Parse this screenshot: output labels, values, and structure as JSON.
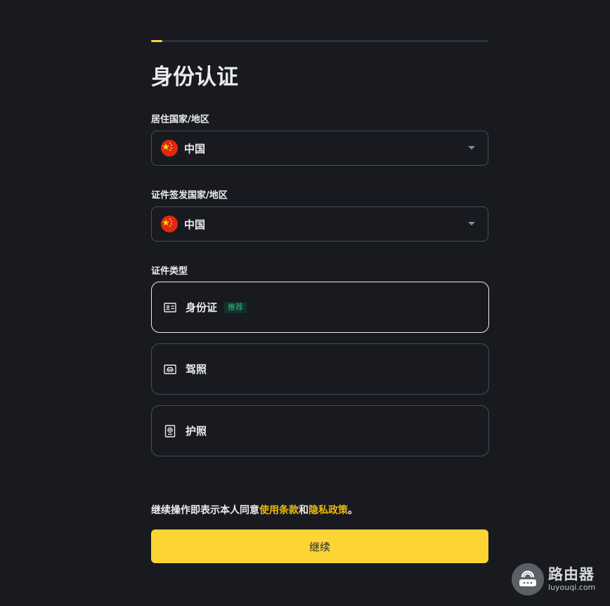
{
  "progress": {
    "value_percent": 3
  },
  "page_title": "身份认证",
  "residence": {
    "label": "居住国家/地区",
    "value": "中国",
    "flag_icon": "china-flag-icon"
  },
  "issuing": {
    "label": "证件签发国家/地区",
    "value": "中国",
    "flag_icon": "china-flag-icon"
  },
  "doc_type": {
    "label": "证件类型",
    "options": [
      {
        "label": "身份证",
        "icon": "id-card-icon",
        "badge": "推荐",
        "selected": true
      },
      {
        "label": "驾照",
        "icon": "driver-license-icon",
        "selected": false
      },
      {
        "label": "护照",
        "icon": "passport-icon",
        "selected": false
      }
    ]
  },
  "terms": {
    "prefix": "继续操作即表示本人同意",
    "terms_link": "使用条款",
    "conjunction": "和",
    "privacy_link": "隐私政策",
    "suffix": "。"
  },
  "continue_label": "继续",
  "watermark": {
    "cn": "路由器",
    "en": "luyouqi.com"
  },
  "colors": {
    "background": "#181a20",
    "accent": "#fcd535",
    "link": "#f0b90b",
    "badge_text": "#2ebd85",
    "border": "#474d57"
  }
}
